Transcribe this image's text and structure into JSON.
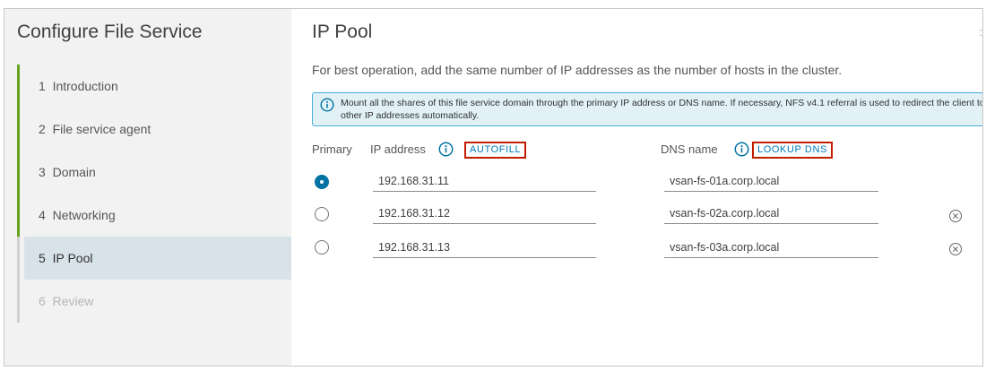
{
  "wizard": {
    "title": "Configure File Service",
    "steps": [
      {
        "number": "1",
        "label": "Introduction",
        "state": "completed"
      },
      {
        "number": "2",
        "label": "File service agent",
        "state": "completed"
      },
      {
        "number": "3",
        "label": "Domain",
        "state": "completed"
      },
      {
        "number": "4",
        "label": "Networking",
        "state": "completed"
      },
      {
        "number": "5",
        "label": "IP Pool",
        "state": "active"
      },
      {
        "number": "6",
        "label": "Review",
        "state": "disabled"
      }
    ]
  },
  "page": {
    "title": "IP Pool",
    "description": "For best operation, add the same number of IP addresses as the number of hosts in the cluster.",
    "alert": "Mount all the shares of this file service domain through the primary IP address or DNS name. If necessary, NFS v4.1 referral is used to redirect the client to other IP addresses automatically."
  },
  "table": {
    "primary_header": "Primary",
    "ip_header": "IP address",
    "dns_header": "DNS name",
    "autofill_label": "AUTOFILL",
    "lookup_dns_label": "LOOKUP DNS",
    "rows": [
      {
        "ip": "192.168.31.11",
        "dns": "vsan-fs-01a.corp.local",
        "primary": true
      },
      {
        "ip": "192.168.31.12",
        "dns": "vsan-fs-02a.corp.local",
        "primary": false
      },
      {
        "ip": "192.168.31.13",
        "dns": "vsan-fs-03a.corp.local",
        "primary": false
      }
    ]
  },
  "colors": {
    "completed_bar": "#62a420",
    "active_step_bg": "#d8e3e9",
    "link_blue": "#0079b8",
    "highlight_red": "#c21d00",
    "alert_bg": "#e1f1f6"
  },
  "icons": {
    "info": "info-circle-icon",
    "remove": "remove-circle-icon",
    "close": "close-icon"
  }
}
